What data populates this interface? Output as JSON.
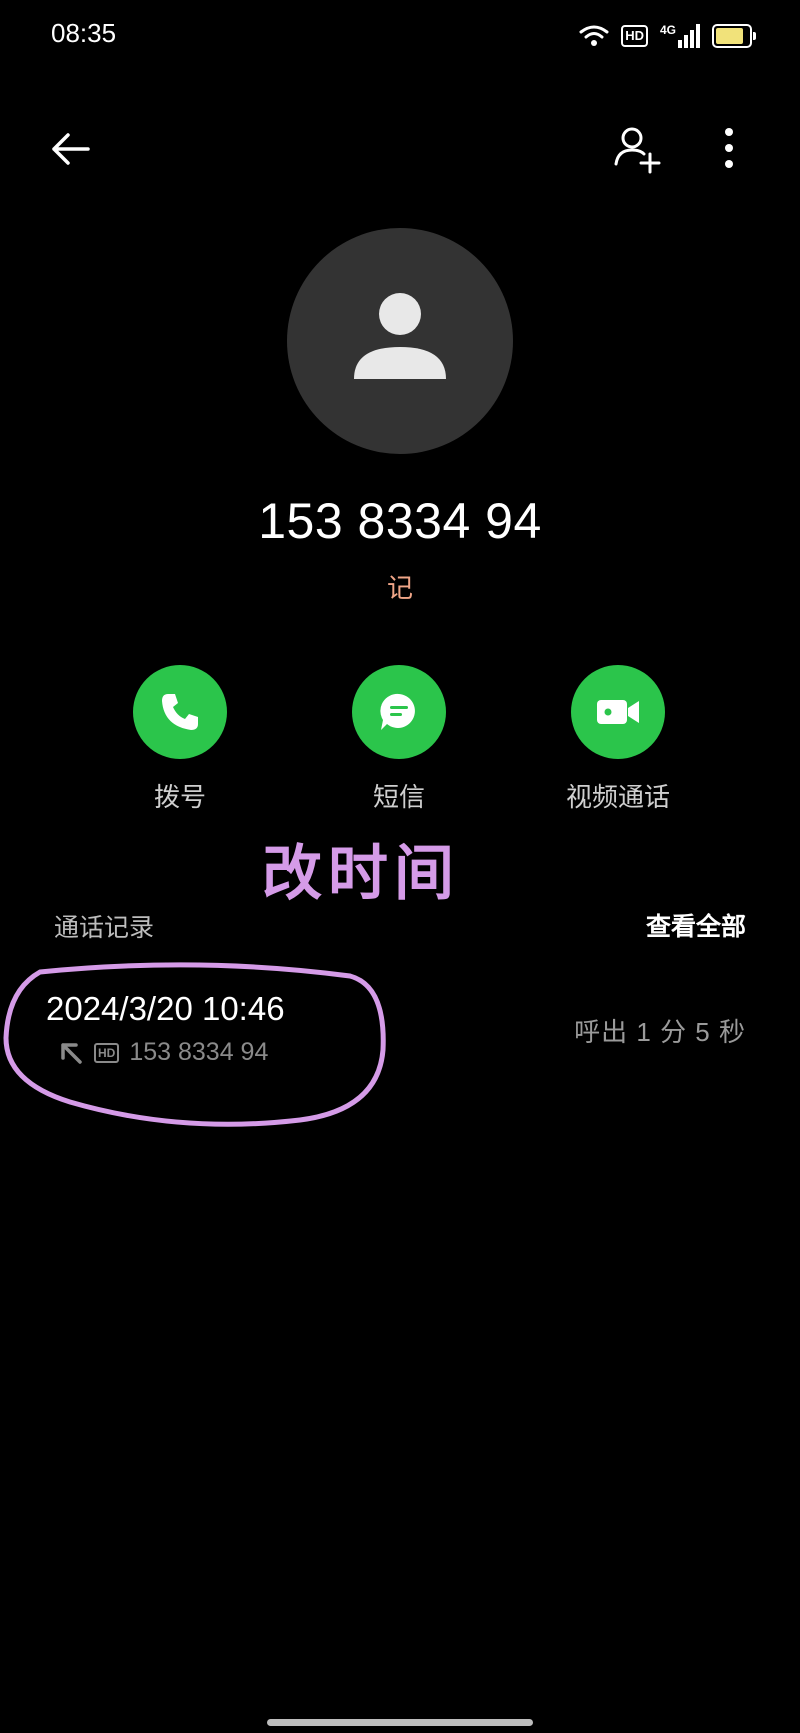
{
  "status_bar": {
    "time": "08:35",
    "hd": "HD",
    "network": "4G",
    "battery_level": 0.9,
    "icons": [
      "wifi-icon",
      "hd-icon",
      "signal-icon",
      "battery-icon"
    ]
  },
  "header": {
    "back_icon": "arrow-left-icon",
    "add_contact_icon": "add-person-icon",
    "more_icon": "more-vertical-icon"
  },
  "contact": {
    "number": "153 8334 94",
    "tag": "记"
  },
  "actions": [
    {
      "label": "拨号",
      "icon": "phone-icon"
    },
    {
      "label": "短信",
      "icon": "message-icon"
    },
    {
      "label": "视频通话",
      "icon": "video-camera-icon"
    }
  ],
  "overlay_text": "改时间",
  "call_log": {
    "title": "通话记录",
    "view_all": "查看全部",
    "entries": [
      {
        "datetime": "2024/3/20 10:46",
        "direction_icon": "outgoing-arrow-icon",
        "hd": "HD",
        "number": "153 8334 94",
        "info": "呼出  1 分 5 秒"
      }
    ]
  },
  "colors": {
    "background": "#000000",
    "action_green": "#2bc54b",
    "tag_orange": "#f0a688",
    "annotation_purple": "#d59be8",
    "avatar_bg": "#333333"
  }
}
